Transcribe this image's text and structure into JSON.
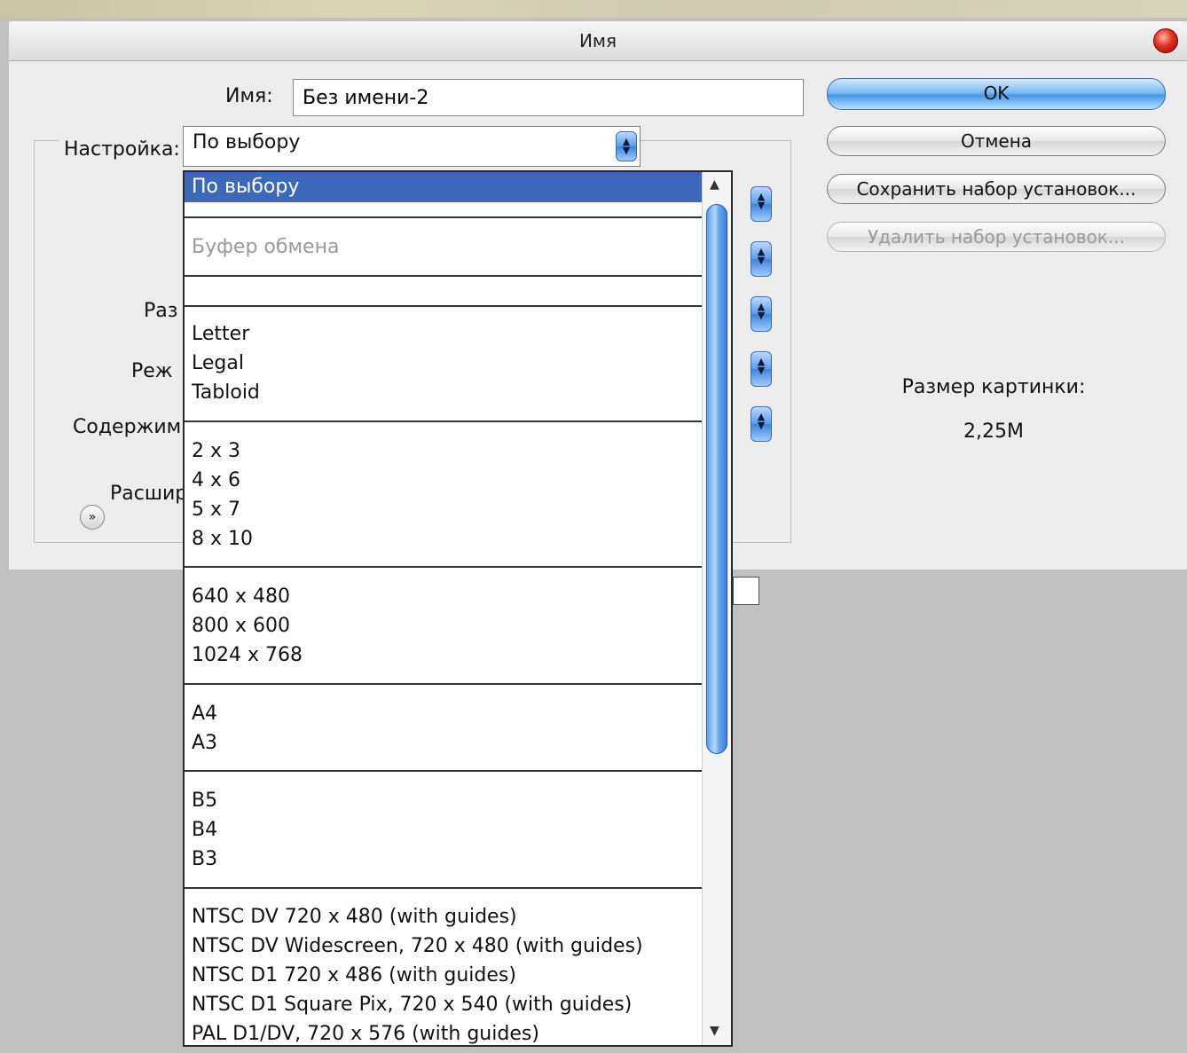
{
  "window": {
    "title": "Имя"
  },
  "form": {
    "name_label": "Имя:",
    "name_value": "Без имени-2",
    "preset_label": "Настройка:",
    "preset_value": "По выбору",
    "partial_labels": [
      "Раз",
      "Реж",
      "Содержим",
      "Расшир"
    ]
  },
  "buttons": {
    "ok": "OK",
    "cancel": "Отмена",
    "save_preset": "Сохранить набор установок...",
    "delete_preset": "Удалить набор установок..."
  },
  "info": {
    "image_size_label": "Размер картинки:",
    "image_size_value": "2,25M"
  },
  "dropdown": {
    "selected": "По выбору",
    "clipboard": "Буфер обмена",
    "paper": [
      "Letter",
      "Legal",
      "Tabloid"
    ],
    "photo": [
      "2 x 3",
      "4 x 6",
      "5 x 7",
      "8 x 10"
    ],
    "screen": [
      "640 x 480",
      "800 x 600",
      "1024 x 768"
    ],
    "iso_a": [
      "A4",
      "A3"
    ],
    "iso_b": [
      "B5",
      "B4",
      "B3"
    ],
    "video": [
      "NTSC DV 720 x 480 (with guides)",
      "NTSC DV Widescreen, 720 x 480 (with guides)",
      "NTSC D1 720 x 486 (with guides)",
      "NTSC D1 Square Pix, 720 x 540 (with guides)",
      "PAL D1/DV, 720 x 576 (with guides)"
    ]
  },
  "icons": {
    "close": "close-icon",
    "spin": "up-down-arrows-icon",
    "scroll_up": "scroll-up-arrow-icon",
    "scroll_down": "scroll-down-arrow-icon",
    "expand": "double-chevron-down-icon"
  },
  "colors": {
    "selection": "#3b68b8",
    "ok_button": "#4a97e6",
    "dialog_bg": "#ececec",
    "desktop_bg": "#c0c0c0"
  }
}
